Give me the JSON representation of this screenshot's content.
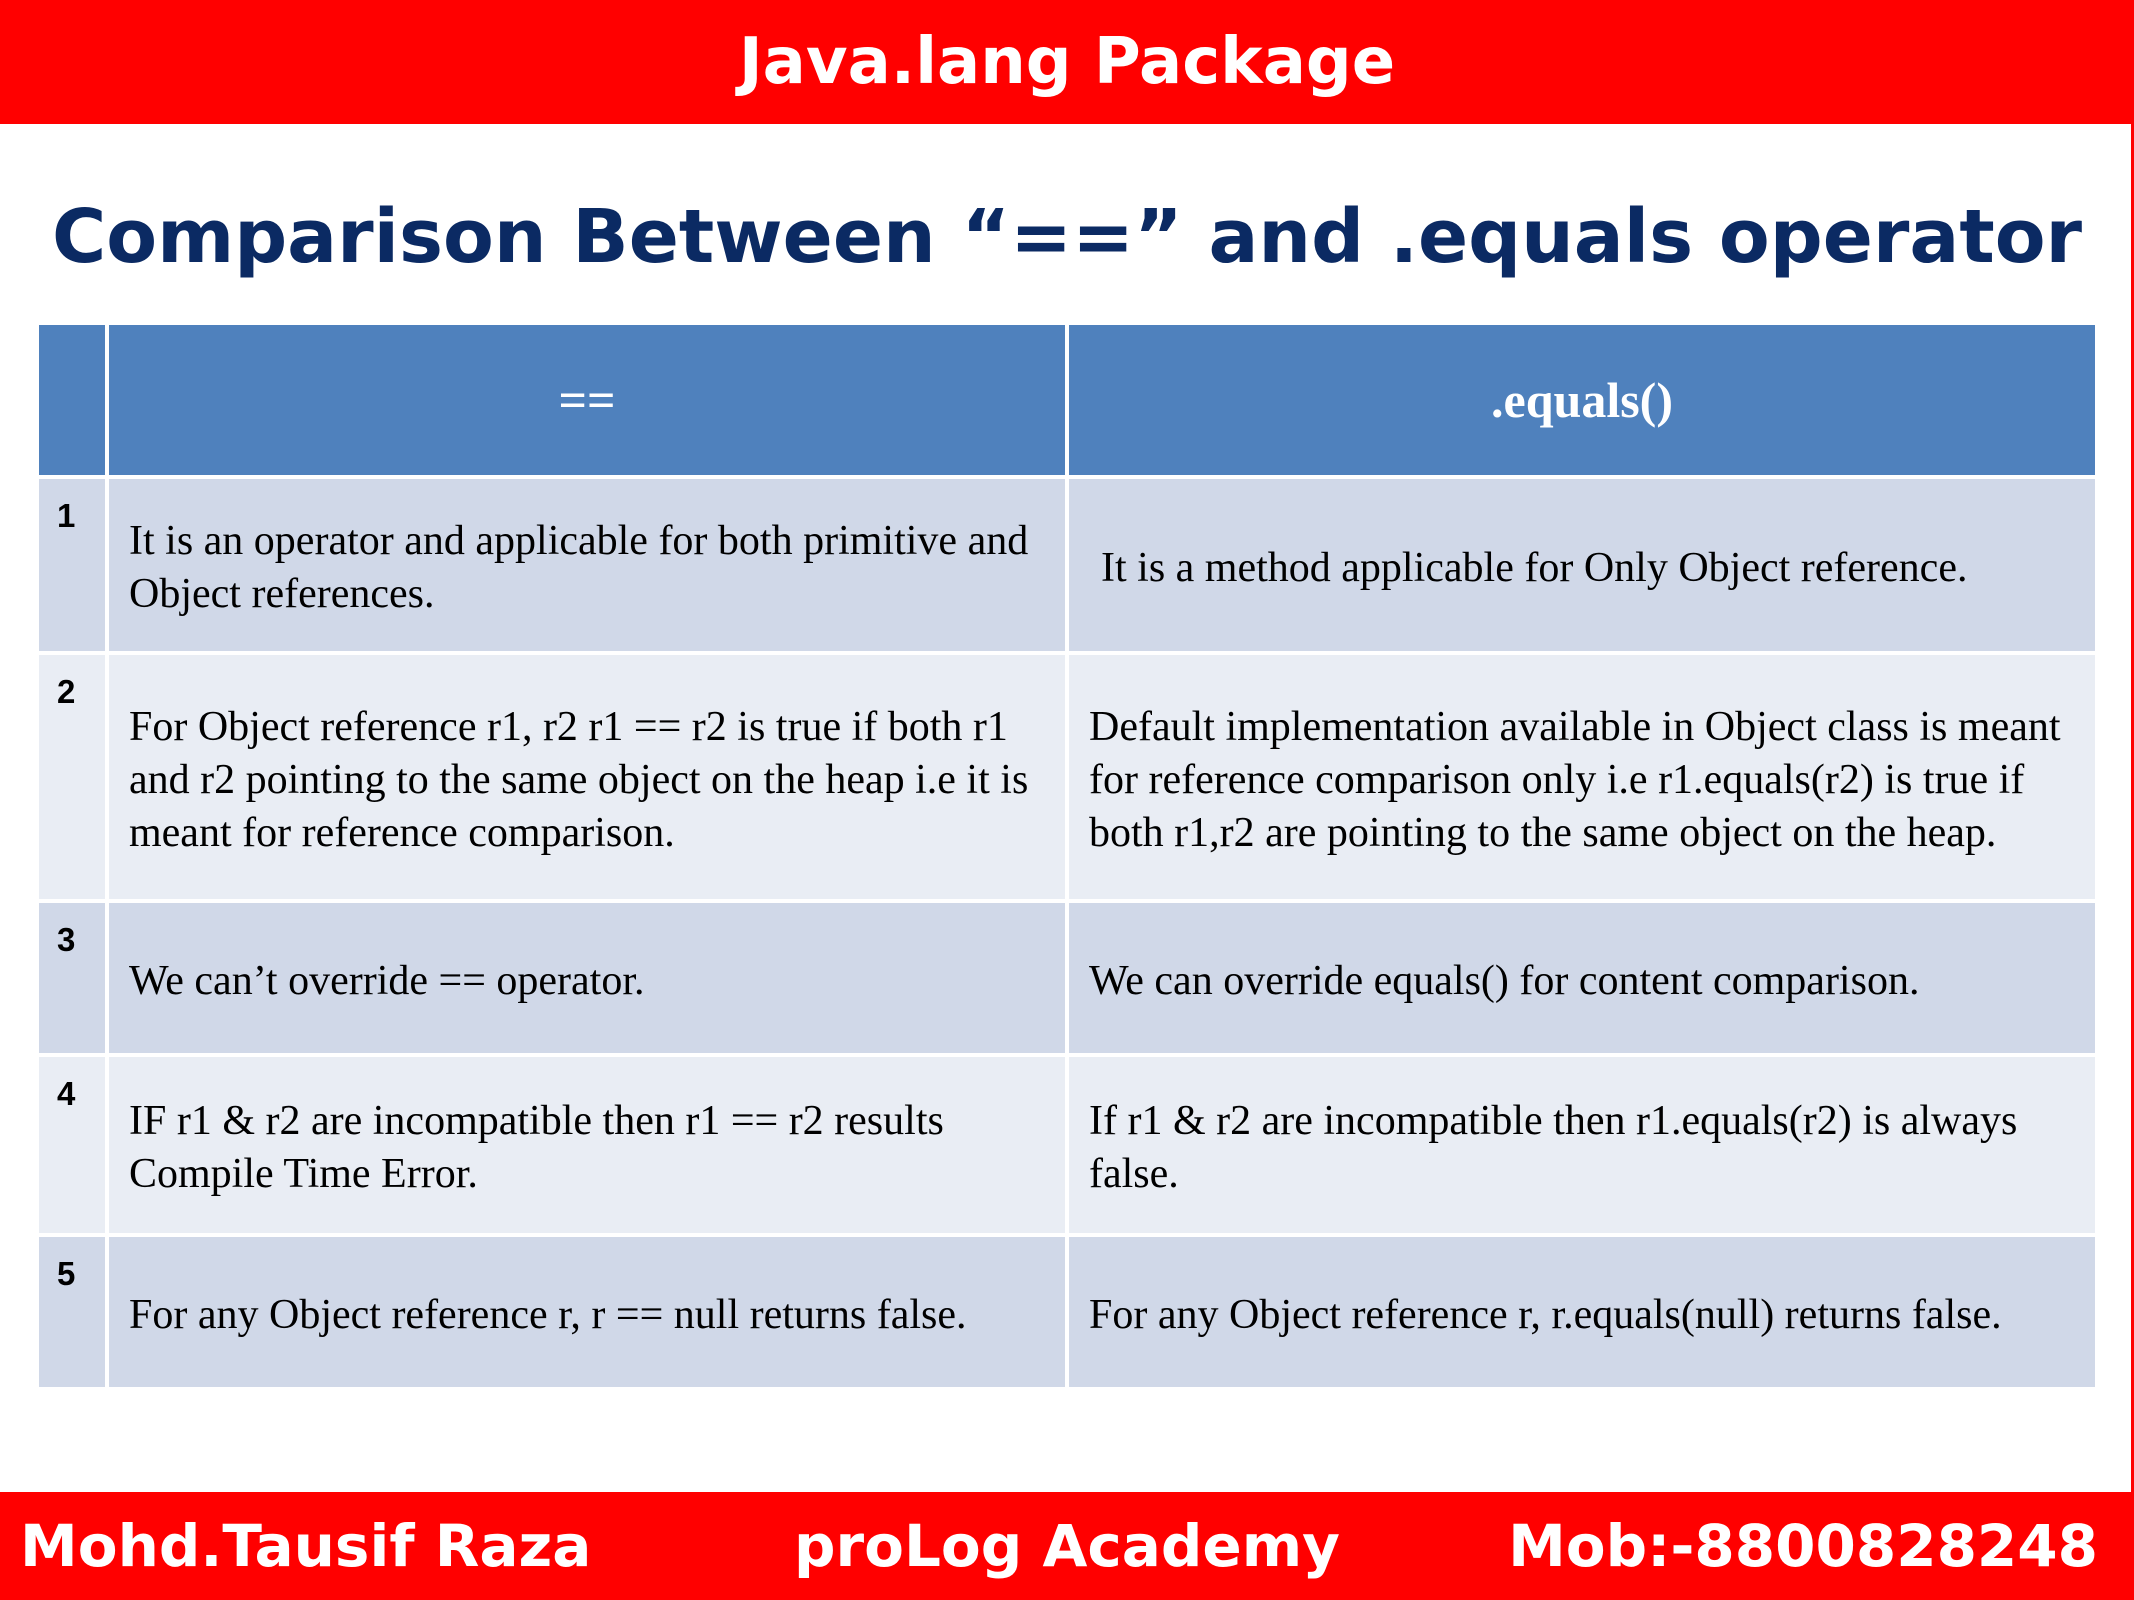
{
  "banner": {
    "title": "Java.lang Package"
  },
  "heading": "Comparison Between “==” and .equals operator",
  "table": {
    "headers": [
      "",
      "==",
      ".equals()"
    ],
    "rows": [
      {
        "num": "1",
        "left": "It is an operator and applicable for both primitive and Object references.",
        "right": "It is a method applicable for Only Object reference."
      },
      {
        "num": "2",
        "left": "For Object reference r1, r2 r1 == r2 is true if both r1 and r2 pointing to the same object on the heap i.e it is meant for reference comparison.",
        "right": "Default implementation available in Object class is meant for reference comparison only i.e r1.equals(r2) is true if both r1,r2 are pointing to the same object on the heap."
      },
      {
        "num": "3",
        "left": "We can’t override == operator.",
        "right": "We can override equals() for content comparison."
      },
      {
        "num": "4",
        "left": "IF r1 & r2 are incompatible then r1 == r2 results Compile Time Error.",
        "right": "If r1 & r2 are incompatible then r1.equals(r2) is always false."
      },
      {
        "num": "5",
        "left": "For any Object reference r, r == null returns false.",
        "right": "For any Object reference r, r.equals(null) returns false."
      }
    ]
  },
  "footer": {
    "author": "Mohd.Tausif Raza",
    "academy": "proLog Academy",
    "phone": "Mob:-8800828248"
  },
  "colors": {
    "banner": "#ff0000",
    "heading": "#0b2a63",
    "table_header": "#4f81bd",
    "row_odd": "#d0d8e8",
    "row_even": "#e9edf4"
  }
}
